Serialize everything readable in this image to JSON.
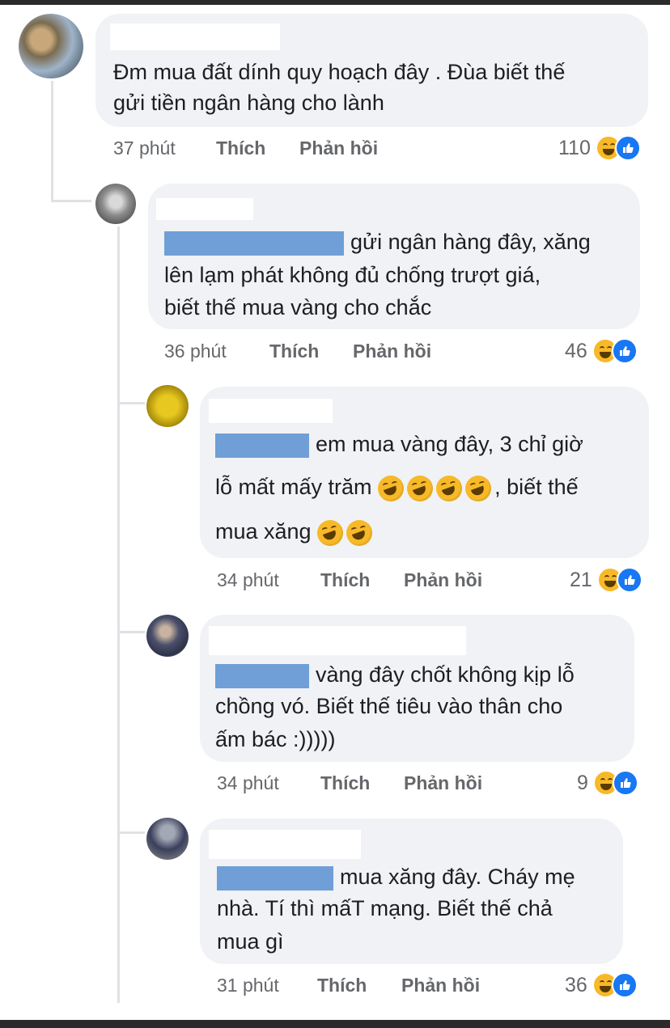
{
  "comments": [
    {
      "lines": [
        "Đm mua đất dính quy hoạch đây . Đùa biết thế",
        "gửi tiền ngân hàng cho lành"
      ],
      "time": "37 phút",
      "like_label": "Thích",
      "reply_label": "Phản hồi",
      "reaction_count": "110"
    },
    {
      "lines": [
        "gửi ngân hàng đây, xăng",
        "lên lạm phát không đủ chống trượt giá,",
        "biết thế mua vàng cho chắc"
      ],
      "time": "36 phút",
      "like_label": "Thích",
      "reply_label": "Phản hồi",
      "reaction_count": "46"
    },
    {
      "lines": [
        "em mua vàng đây, 3 chỉ giờ",
        "lỗ mất mấy trăm",
        ", biết thế",
        "mua xăng"
      ],
      "time": "34 phút",
      "like_label": "Thích",
      "reply_label": "Phản hồi",
      "reaction_count": "21"
    },
    {
      "lines": [
        "vàng đây chốt không kịp lỗ",
        "chồng vó. Biết thế tiêu vào thân cho",
        "ấm bác :)))))"
      ],
      "time": "34 phút",
      "like_label": "Thích",
      "reply_label": "Phản hồi",
      "reaction_count": "9"
    },
    {
      "lines": [
        "mua xăng đây. Cháy mẹ",
        "nhà. Tí thì mấT mạng. Biết thế chả",
        "mua gì"
      ],
      "time": "31 phút",
      "like_label": "Thích",
      "reply_label": "Phản hồi",
      "reaction_count": "36"
    }
  ],
  "icons": {
    "reaction_haha": "haha-emoji",
    "reaction_like": "like-thumb",
    "inline_emoji": "rofl-emoji"
  },
  "colors": {
    "bubble": "#f0f2f5",
    "meta": "#65676b",
    "redaction": "#6f9fd6",
    "like": "#1877f2",
    "haha": "#f7b928"
  }
}
